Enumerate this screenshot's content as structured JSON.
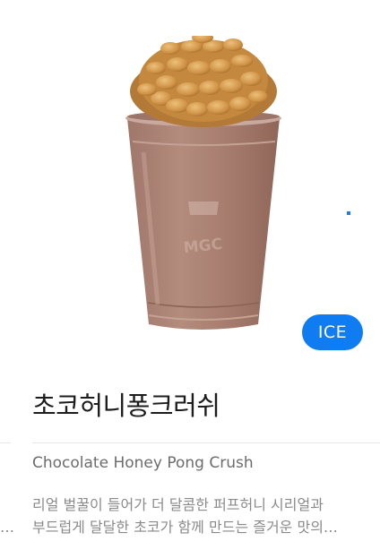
{
  "product": {
    "badge": "ICE",
    "name_ko": "초코허니퐁크러쉬",
    "name_en": "Chocolate Honey Pong Crush",
    "description_lines": [
      "리얼 벌꿀이 들어가 더 달콤한 퍼프허니 시리얼과",
      "부드럽게 달달한 초코가 함께 만드는 즐거운 맛의…"
    ],
    "cup_logo": "MGC"
  },
  "edge": {
    "ellipsis": "…"
  },
  "colors": {
    "accent": "#0f7cf2",
    "drink": "#a97f70",
    "cereal": "#d49a4c",
    "title": "#1c1c1c",
    "subtitle": "#6c6c6c",
    "description": "#8a8a8a"
  }
}
